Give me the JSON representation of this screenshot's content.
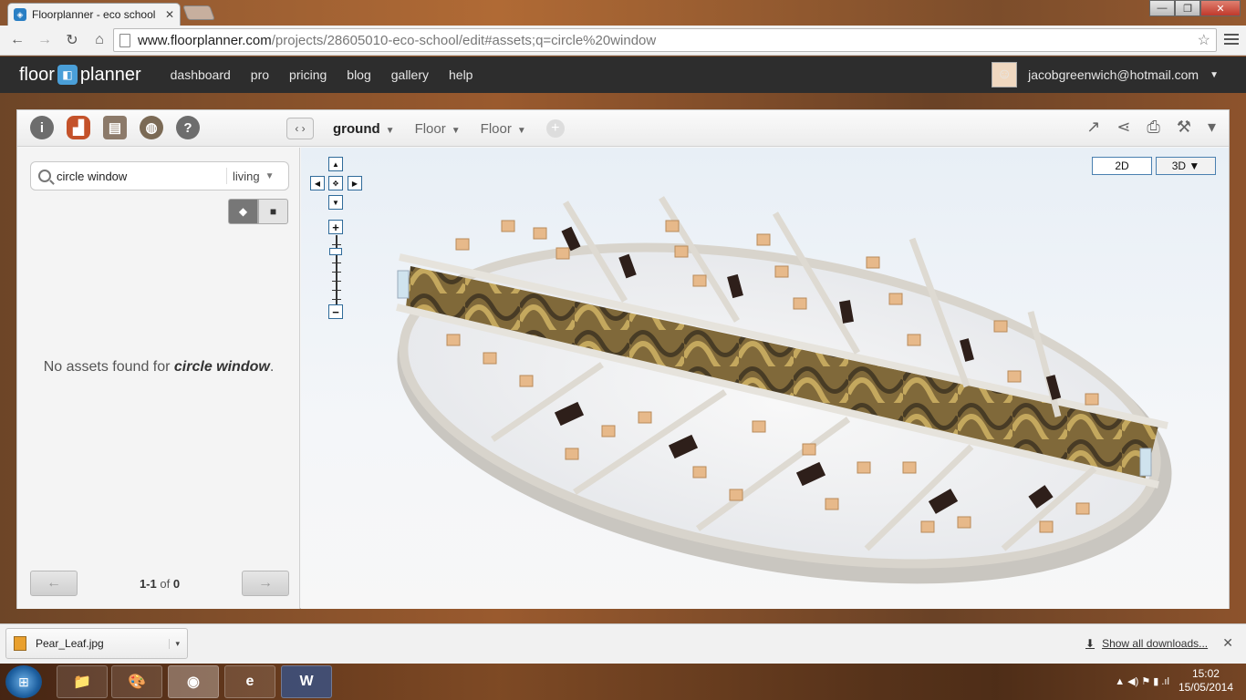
{
  "browser": {
    "tab_title": "Floorplanner - eco school",
    "tab_close": "✕",
    "url_host": "www.floorplanner.com",
    "url_path": "/projects/28605010-eco-school/edit#assets;q=circle%20window",
    "back": "←",
    "forward": "→",
    "reload": "↻",
    "home": "⌂",
    "star": "☆",
    "win_min": "—",
    "win_max": "❐",
    "win_close": "✕"
  },
  "header": {
    "logo_left": "floor",
    "logo_right": "planner",
    "nav": [
      "dashboard",
      "pro",
      "pricing",
      "blog",
      "gallery",
      "help"
    ],
    "user_email": "jacobgreenwich@hotmail.com",
    "caret": "▼"
  },
  "toolbar": {
    "tools": [
      "i",
      "",
      "",
      "",
      "?"
    ],
    "collapse": "‹ ›",
    "floor_active": "ground",
    "floor_others": [
      "Floor",
      "Floor"
    ],
    "dd": "▼",
    "add_floor": "+",
    "right_tools": [
      "↗",
      "⋖",
      "⎙",
      "⚒",
      "▾"
    ]
  },
  "sidebar": {
    "search_value": "circle window",
    "category": "living",
    "category_dd": "▼",
    "no_assets_prefix": "No assets found for ",
    "no_assets_query": "circle window",
    "no_assets_suffix": ".",
    "pager_prev": "←",
    "pager_next": "→",
    "pager_range": "1-1",
    "pager_of": "of",
    "pager_total": "0"
  },
  "canvas": {
    "nav_up": "▲",
    "nav_down": "▼",
    "nav_left": "◀",
    "nav_right": "▶",
    "nav_center": "✥",
    "zoom_in": "+",
    "zoom_out": "−",
    "view_2d": "2D",
    "view_3d": "3D ▼"
  },
  "downloads": {
    "file_name": "Pear_Leaf.jpg",
    "dd": "▾",
    "show_all": "Show all downloads...",
    "close": "✕"
  },
  "taskbar": {
    "start": "⊞",
    "apps": [
      "📁",
      "🎨",
      "◉",
      "e",
      "W"
    ],
    "time": "15:02",
    "date": "15/05/2014",
    "tray_icons": "▲ ◀) ⚑ ▮ .ıl"
  },
  "colors": {
    "app_header": "#2d2d2d",
    "logo_accent": "#4a9fd8",
    "link_blue": "#2f6b9a"
  }
}
